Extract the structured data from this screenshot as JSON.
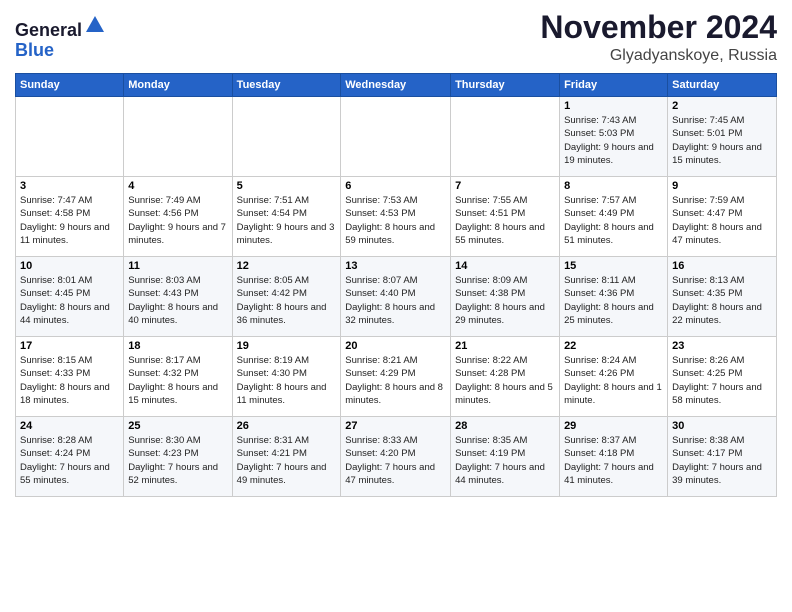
{
  "header": {
    "logo_general": "General",
    "logo_blue": "Blue",
    "month_title": "November 2024",
    "location": "Glyadyanskoye, Russia"
  },
  "weekdays": [
    "Sunday",
    "Monday",
    "Tuesday",
    "Wednesday",
    "Thursday",
    "Friday",
    "Saturday"
  ],
  "weeks": [
    [
      {
        "day": "",
        "info": ""
      },
      {
        "day": "",
        "info": ""
      },
      {
        "day": "",
        "info": ""
      },
      {
        "day": "",
        "info": ""
      },
      {
        "day": "",
        "info": ""
      },
      {
        "day": "1",
        "info": "Sunrise: 7:43 AM\nSunset: 5:03 PM\nDaylight: 9 hours and 19 minutes."
      },
      {
        "day": "2",
        "info": "Sunrise: 7:45 AM\nSunset: 5:01 PM\nDaylight: 9 hours and 15 minutes."
      }
    ],
    [
      {
        "day": "3",
        "info": "Sunrise: 7:47 AM\nSunset: 4:58 PM\nDaylight: 9 hours and 11 minutes."
      },
      {
        "day": "4",
        "info": "Sunrise: 7:49 AM\nSunset: 4:56 PM\nDaylight: 9 hours and 7 minutes."
      },
      {
        "day": "5",
        "info": "Sunrise: 7:51 AM\nSunset: 4:54 PM\nDaylight: 9 hours and 3 minutes."
      },
      {
        "day": "6",
        "info": "Sunrise: 7:53 AM\nSunset: 4:53 PM\nDaylight: 8 hours and 59 minutes."
      },
      {
        "day": "7",
        "info": "Sunrise: 7:55 AM\nSunset: 4:51 PM\nDaylight: 8 hours and 55 minutes."
      },
      {
        "day": "8",
        "info": "Sunrise: 7:57 AM\nSunset: 4:49 PM\nDaylight: 8 hours and 51 minutes."
      },
      {
        "day": "9",
        "info": "Sunrise: 7:59 AM\nSunset: 4:47 PM\nDaylight: 8 hours and 47 minutes."
      }
    ],
    [
      {
        "day": "10",
        "info": "Sunrise: 8:01 AM\nSunset: 4:45 PM\nDaylight: 8 hours and 44 minutes."
      },
      {
        "day": "11",
        "info": "Sunrise: 8:03 AM\nSunset: 4:43 PM\nDaylight: 8 hours and 40 minutes."
      },
      {
        "day": "12",
        "info": "Sunrise: 8:05 AM\nSunset: 4:42 PM\nDaylight: 8 hours and 36 minutes."
      },
      {
        "day": "13",
        "info": "Sunrise: 8:07 AM\nSunset: 4:40 PM\nDaylight: 8 hours and 32 minutes."
      },
      {
        "day": "14",
        "info": "Sunrise: 8:09 AM\nSunset: 4:38 PM\nDaylight: 8 hours and 29 minutes."
      },
      {
        "day": "15",
        "info": "Sunrise: 8:11 AM\nSunset: 4:36 PM\nDaylight: 8 hours and 25 minutes."
      },
      {
        "day": "16",
        "info": "Sunrise: 8:13 AM\nSunset: 4:35 PM\nDaylight: 8 hours and 22 minutes."
      }
    ],
    [
      {
        "day": "17",
        "info": "Sunrise: 8:15 AM\nSunset: 4:33 PM\nDaylight: 8 hours and 18 minutes."
      },
      {
        "day": "18",
        "info": "Sunrise: 8:17 AM\nSunset: 4:32 PM\nDaylight: 8 hours and 15 minutes."
      },
      {
        "day": "19",
        "info": "Sunrise: 8:19 AM\nSunset: 4:30 PM\nDaylight: 8 hours and 11 minutes."
      },
      {
        "day": "20",
        "info": "Sunrise: 8:21 AM\nSunset: 4:29 PM\nDaylight: 8 hours and 8 minutes."
      },
      {
        "day": "21",
        "info": "Sunrise: 8:22 AM\nSunset: 4:28 PM\nDaylight: 8 hours and 5 minutes."
      },
      {
        "day": "22",
        "info": "Sunrise: 8:24 AM\nSunset: 4:26 PM\nDaylight: 8 hours and 1 minute."
      },
      {
        "day": "23",
        "info": "Sunrise: 8:26 AM\nSunset: 4:25 PM\nDaylight: 7 hours and 58 minutes."
      }
    ],
    [
      {
        "day": "24",
        "info": "Sunrise: 8:28 AM\nSunset: 4:24 PM\nDaylight: 7 hours and 55 minutes."
      },
      {
        "day": "25",
        "info": "Sunrise: 8:30 AM\nSunset: 4:23 PM\nDaylight: 7 hours and 52 minutes."
      },
      {
        "day": "26",
        "info": "Sunrise: 8:31 AM\nSunset: 4:21 PM\nDaylight: 7 hours and 49 minutes."
      },
      {
        "day": "27",
        "info": "Sunrise: 8:33 AM\nSunset: 4:20 PM\nDaylight: 7 hours and 47 minutes."
      },
      {
        "day": "28",
        "info": "Sunrise: 8:35 AM\nSunset: 4:19 PM\nDaylight: 7 hours and 44 minutes."
      },
      {
        "day": "29",
        "info": "Sunrise: 8:37 AM\nSunset: 4:18 PM\nDaylight: 7 hours and 41 minutes."
      },
      {
        "day": "30",
        "info": "Sunrise: 8:38 AM\nSunset: 4:17 PM\nDaylight: 7 hours and 39 minutes."
      }
    ]
  ]
}
